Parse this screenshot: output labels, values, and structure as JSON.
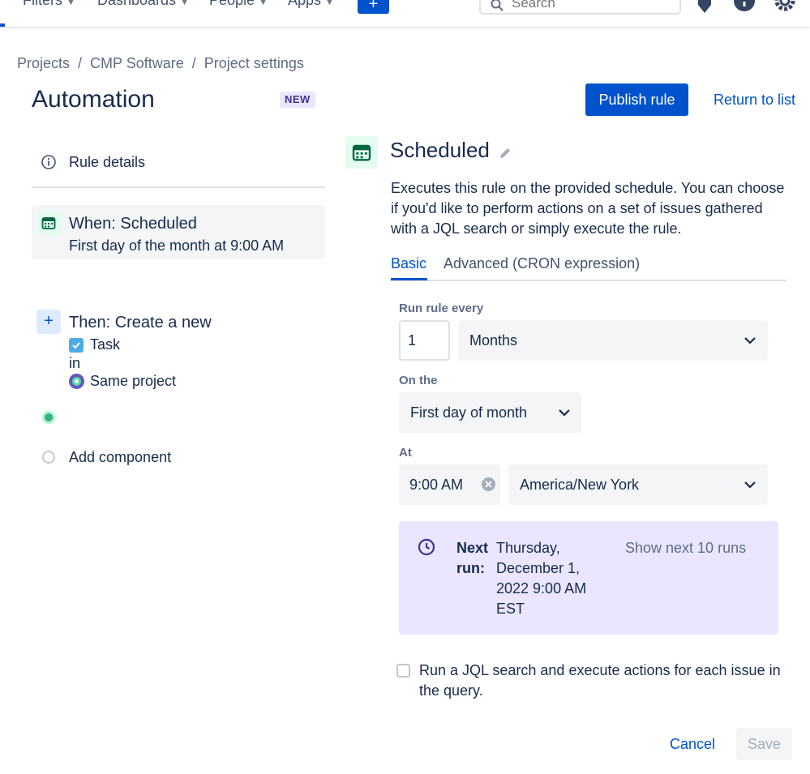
{
  "topnav": {
    "items": [
      {
        "label": "Filters"
      },
      {
        "label": "Dashboards"
      },
      {
        "label": "People"
      },
      {
        "label": "Apps"
      }
    ],
    "create_label": "+",
    "search_placeholder": "Search",
    "icons": [
      "notifications-icon",
      "help-icon",
      "settings-icon"
    ]
  },
  "breadcrumb": {
    "items": [
      "Projects",
      "CMP Software",
      "Project settings"
    ],
    "separator": "/"
  },
  "header": {
    "title": "Automation",
    "badge": "NEW",
    "publish_label": "Publish rule",
    "return_label": "Return to list"
  },
  "left_panel": {
    "rule_details_label": "Rule details",
    "when": {
      "title": "When: Scheduled",
      "subtitle": "First day of the month at 9:00 AM"
    },
    "then": {
      "title": "Then: Create a new",
      "issue_type": "Task",
      "in_label": "in",
      "project": "Same project"
    },
    "add_component_label": "Add component"
  },
  "trigger": {
    "title": "Scheduled",
    "description": "Executes this rule on the provided schedule. You can choose if you'd like to perform actions on a set of issues gathered with a JQL search or simply execute the rule.",
    "tabs": [
      {
        "label": "Basic",
        "active": true
      },
      {
        "label": "Advanced (CRON expression)",
        "active": false
      }
    ],
    "run_every": {
      "label": "Run rule every",
      "value": "1",
      "unit": "Months"
    },
    "on_the": {
      "label": "On the",
      "value": "First day of month"
    },
    "at": {
      "label": "At",
      "time": "9:00 AM",
      "timezone": "America/New York"
    },
    "next_run": {
      "label": "Next run:",
      "value": "Thursday, December 1, 2022 9:00 AM EST",
      "link": "Show next 10 runs"
    },
    "jql_label": "Run a JQL search and execute actions for each issue in the query.",
    "cancel_label": "Cancel",
    "save_label": "Save"
  },
  "colors": {
    "primary": "#0052cc",
    "text": "#172b4d",
    "muted": "#5e6c84",
    "next_run_bg": "#eae6ff",
    "success": "#36b37e"
  }
}
